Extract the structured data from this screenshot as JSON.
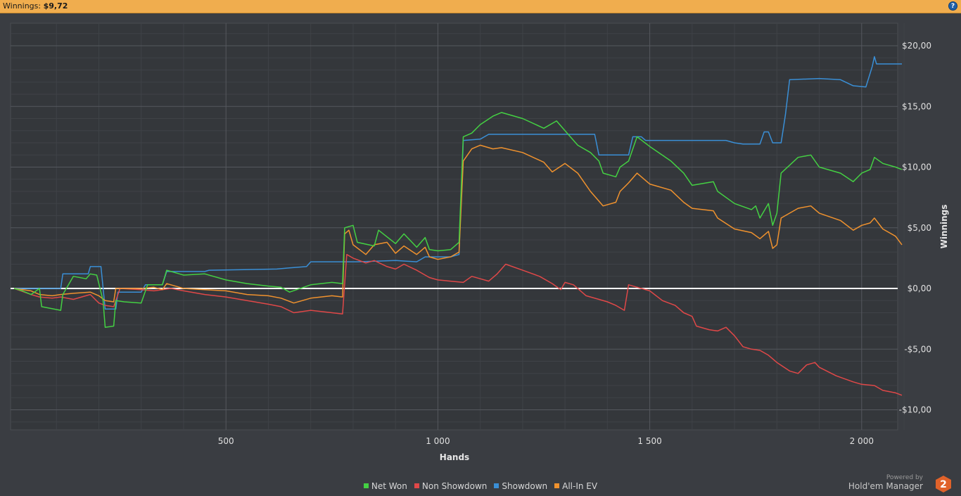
{
  "header": {
    "winnings_label": "Winnings:",
    "winnings_value": "$9,72",
    "help_icon": "help-icon"
  },
  "chart_data": {
    "type": "line",
    "xlabel": "Hands",
    "ylabel": "Winnings",
    "xlim": [
      0,
      2100
    ],
    "ylim": [
      -11.5,
      21.5
    ],
    "x_ticks": [
      500,
      1000,
      1500,
      2000
    ],
    "x_tick_labels": [
      "500",
      "1 000",
      "1 500",
      "2 000"
    ],
    "y_ticks": [
      20,
      15,
      10,
      5,
      0,
      -5,
      -10
    ],
    "y_tick_labels": [
      "$20,00",
      "$15,00",
      "$10,00",
      "$5,00",
      "$0,00",
      "-$5,00",
      "-$10,00"
    ],
    "grid": true,
    "legend_position": "bottom-center",
    "zero_line": true,
    "series": [
      {
        "name": "Net Won",
        "color": "#44d043",
        "points": [
          [
            0,
            0
          ],
          [
            20,
            -0.2
          ],
          [
            40,
            -0.5
          ],
          [
            60,
            0
          ],
          [
            65,
            -1.5
          ],
          [
            110,
            -1.8
          ],
          [
            115,
            -0.5
          ],
          [
            140,
            1
          ],
          [
            170,
            0.8
          ],
          [
            180,
            1.2
          ],
          [
            195,
            1.1
          ],
          [
            210,
            -1
          ],
          [
            215,
            -3.2
          ],
          [
            235,
            -3.1
          ],
          [
            240,
            -1
          ],
          [
            260,
            -1.1
          ],
          [
            300,
            -1.2
          ],
          [
            315,
            0.3
          ],
          [
            350,
            0.3
          ],
          [
            360,
            1.5
          ],
          [
            400,
            1.1
          ],
          [
            450,
            1.2
          ],
          [
            500,
            0.7
          ],
          [
            550,
            0.4
          ],
          [
            600,
            0.2
          ],
          [
            630,
            0.1
          ],
          [
            650,
            -0.3
          ],
          [
            700,
            0.3
          ],
          [
            750,
            0.5
          ],
          [
            775,
            0.4
          ],
          [
            780,
            5
          ],
          [
            800,
            5.2
          ],
          [
            810,
            3.8
          ],
          [
            850,
            3.5
          ],
          [
            860,
            4.8
          ],
          [
            900,
            3.7
          ],
          [
            920,
            4.5
          ],
          [
            950,
            3.4
          ],
          [
            970,
            4.2
          ],
          [
            980,
            3.2
          ],
          [
            1000,
            3.1
          ],
          [
            1030,
            3.2
          ],
          [
            1050,
            3.8
          ],
          [
            1060,
            12.5
          ],
          [
            1080,
            12.8
          ],
          [
            1100,
            13.5
          ],
          [
            1130,
            14.2
          ],
          [
            1150,
            14.5
          ],
          [
            1200,
            14
          ],
          [
            1250,
            13.2
          ],
          [
            1280,
            13.8
          ],
          [
            1300,
            13
          ],
          [
            1330,
            11.8
          ],
          [
            1360,
            11.2
          ],
          [
            1380,
            10.5
          ],
          [
            1390,
            9.5
          ],
          [
            1420,
            9.2
          ],
          [
            1430,
            10
          ],
          [
            1450,
            10.5
          ],
          [
            1470,
            12.5
          ],
          [
            1500,
            11.7
          ],
          [
            1550,
            10.5
          ],
          [
            1580,
            9.5
          ],
          [
            1600,
            8.5
          ],
          [
            1650,
            8.8
          ],
          [
            1660,
            8
          ],
          [
            1700,
            7
          ],
          [
            1740,
            6.5
          ],
          [
            1750,
            6.8
          ],
          [
            1760,
            5.8
          ],
          [
            1780,
            7
          ],
          [
            1790,
            5.2
          ],
          [
            1800,
            6.2
          ],
          [
            1810,
            9.5
          ],
          [
            1850,
            10.8
          ],
          [
            1880,
            11
          ],
          [
            1900,
            10
          ],
          [
            1950,
            9.5
          ],
          [
            1980,
            8.8
          ],
          [
            2000,
            9.5
          ],
          [
            2020,
            9.8
          ],
          [
            2030,
            10.8
          ],
          [
            2050,
            10.3
          ],
          [
            2080,
            10
          ],
          [
            2095,
            9.8
          ]
        ]
      },
      {
        "name": "Non Showdown",
        "color": "#e04848",
        "points": [
          [
            0,
            0
          ],
          [
            40,
            -0.5
          ],
          [
            60,
            -0.7
          ],
          [
            90,
            -0.8
          ],
          [
            110,
            -0.7
          ],
          [
            140,
            -0.9
          ],
          [
            180,
            -0.5
          ],
          [
            200,
            -1.2
          ],
          [
            215,
            -1.4
          ],
          [
            235,
            -1.5
          ],
          [
            250,
            0
          ],
          [
            300,
            -0.1
          ],
          [
            330,
            -0.2
          ],
          [
            370,
            0
          ],
          [
            400,
            -0.2
          ],
          [
            450,
            -0.5
          ],
          [
            500,
            -0.7
          ],
          [
            550,
            -1
          ],
          [
            600,
            -1.3
          ],
          [
            630,
            -1.5
          ],
          [
            660,
            -2
          ],
          [
            700,
            -1.8
          ],
          [
            750,
            -2
          ],
          [
            775,
            -2.1
          ],
          [
            785,
            2.8
          ],
          [
            800,
            2.5
          ],
          [
            830,
            2.1
          ],
          [
            850,
            2.3
          ],
          [
            880,
            1.8
          ],
          [
            900,
            1.6
          ],
          [
            920,
            2
          ],
          [
            950,
            1.5
          ],
          [
            980,
            0.9
          ],
          [
            1000,
            0.7
          ],
          [
            1030,
            0.6
          ],
          [
            1060,
            0.5
          ],
          [
            1080,
            1
          ],
          [
            1100,
            0.8
          ],
          [
            1120,
            0.6
          ],
          [
            1140,
            1.2
          ],
          [
            1160,
            2
          ],
          [
            1200,
            1.5
          ],
          [
            1240,
            1
          ],
          [
            1270,
            0.4
          ],
          [
            1290,
            -0.1
          ],
          [
            1300,
            0.5
          ],
          [
            1320,
            0.3
          ],
          [
            1350,
            -0.6
          ],
          [
            1380,
            -0.9
          ],
          [
            1400,
            -1.1
          ],
          [
            1420,
            -1.4
          ],
          [
            1440,
            -1.8
          ],
          [
            1450,
            0.3
          ],
          [
            1480,
            0
          ],
          [
            1500,
            -0.2
          ],
          [
            1530,
            -1
          ],
          [
            1560,
            -1.4
          ],
          [
            1580,
            -2
          ],
          [
            1600,
            -2.3
          ],
          [
            1610,
            -3.1
          ],
          [
            1640,
            -3.4
          ],
          [
            1660,
            -3.5
          ],
          [
            1680,
            -3.2
          ],
          [
            1700,
            -3.9
          ],
          [
            1720,
            -4.8
          ],
          [
            1740,
            -5
          ],
          [
            1760,
            -5.1
          ],
          [
            1780,
            -5.5
          ],
          [
            1800,
            -6.1
          ],
          [
            1830,
            -6.8
          ],
          [
            1850,
            -7
          ],
          [
            1870,
            -6.3
          ],
          [
            1890,
            -6.1
          ],
          [
            1900,
            -6.5
          ],
          [
            1940,
            -7.2
          ],
          [
            1980,
            -7.7
          ],
          [
            2000,
            -7.9
          ],
          [
            2030,
            -8
          ],
          [
            2050,
            -8.4
          ],
          [
            2080,
            -8.6
          ],
          [
            2095,
            -8.8
          ]
        ]
      },
      {
        "name": "Showdown",
        "color": "#3a8fd6",
        "points": [
          [
            0,
            0
          ],
          [
            110,
            0
          ],
          [
            115,
            1.2
          ],
          [
            175,
            1.2
          ],
          [
            180,
            1.8
          ],
          [
            205,
            1.8
          ],
          [
            215,
            -1.7
          ],
          [
            240,
            -1.7
          ],
          [
            245,
            -0.3
          ],
          [
            300,
            -0.3
          ],
          [
            310,
            0.3
          ],
          [
            350,
            0.3
          ],
          [
            360,
            1.4
          ],
          [
            450,
            1.4
          ],
          [
            460,
            1.5
          ],
          [
            620,
            1.6
          ],
          [
            650,
            1.7
          ],
          [
            690,
            1.8
          ],
          [
            700,
            2.2
          ],
          [
            800,
            2.2
          ],
          [
            810,
            2.2
          ],
          [
            900,
            2.3
          ],
          [
            950,
            2.2
          ],
          [
            970,
            2.6
          ],
          [
            1000,
            2.6
          ],
          [
            1030,
            2.6
          ],
          [
            1050,
            2.8
          ],
          [
            1060,
            12.2
          ],
          [
            1100,
            12.3
          ],
          [
            1120,
            12.7
          ],
          [
            1200,
            12.7
          ],
          [
            1300,
            12.7
          ],
          [
            1370,
            12.7
          ],
          [
            1380,
            11
          ],
          [
            1420,
            11
          ],
          [
            1440,
            11
          ],
          [
            1450,
            11
          ],
          [
            1460,
            12.5
          ],
          [
            1480,
            12.5
          ],
          [
            1490,
            12.2
          ],
          [
            1680,
            12.2
          ],
          [
            1700,
            12
          ],
          [
            1720,
            11.9
          ],
          [
            1760,
            11.9
          ],
          [
            1770,
            12.9
          ],
          [
            1780,
            12.9
          ],
          [
            1790,
            12
          ],
          [
            1810,
            12
          ],
          [
            1820,
            14.3
          ],
          [
            1830,
            17.2
          ],
          [
            1900,
            17.3
          ],
          [
            1950,
            17.2
          ],
          [
            1980,
            16.7
          ],
          [
            2010,
            16.6
          ],
          [
            2025,
            18.3
          ],
          [
            2030,
            19.1
          ],
          [
            2035,
            18.5
          ],
          [
            2095,
            18.5
          ]
        ]
      },
      {
        "name": "All-In EV",
        "color": "#f0922e",
        "points": [
          [
            0,
            0
          ],
          [
            40,
            -0.2
          ],
          [
            60,
            -0.5
          ],
          [
            90,
            -0.6
          ],
          [
            110,
            -0.5
          ],
          [
            140,
            -0.4
          ],
          [
            180,
            -0.3
          ],
          [
            200,
            -0.6
          ],
          [
            215,
            -1
          ],
          [
            235,
            -1.1
          ],
          [
            240,
            0
          ],
          [
            300,
            0
          ],
          [
            330,
            0.1
          ],
          [
            350,
            -0.1
          ],
          [
            360,
            0.4
          ],
          [
            400,
            0
          ],
          [
            450,
            -0.1
          ],
          [
            500,
            -0.2
          ],
          [
            550,
            -0.5
          ],
          [
            600,
            -0.6
          ],
          [
            630,
            -0.8
          ],
          [
            660,
            -1.2
          ],
          [
            700,
            -0.8
          ],
          [
            750,
            -0.6
          ],
          [
            775,
            -0.7
          ],
          [
            780,
            4.5
          ],
          [
            790,
            4.8
          ],
          [
            800,
            3.6
          ],
          [
            830,
            2.8
          ],
          [
            850,
            3.6
          ],
          [
            880,
            3.8
          ],
          [
            900,
            2.9
          ],
          [
            920,
            3.5
          ],
          [
            950,
            2.8
          ],
          [
            970,
            3.4
          ],
          [
            980,
            2.6
          ],
          [
            1000,
            2.4
          ],
          [
            1030,
            2.6
          ],
          [
            1050,
            3
          ],
          [
            1060,
            10.5
          ],
          [
            1080,
            11.5
          ],
          [
            1100,
            11.8
          ],
          [
            1130,
            11.5
          ],
          [
            1150,
            11.6
          ],
          [
            1200,
            11.2
          ],
          [
            1250,
            10.4
          ],
          [
            1270,
            9.6
          ],
          [
            1300,
            10.3
          ],
          [
            1330,
            9.5
          ],
          [
            1360,
            8
          ],
          [
            1390,
            6.8
          ],
          [
            1420,
            7.1
          ],
          [
            1430,
            8
          ],
          [
            1450,
            8.7
          ],
          [
            1470,
            9.5
          ],
          [
            1500,
            8.6
          ],
          [
            1550,
            8.1
          ],
          [
            1580,
            7.1
          ],
          [
            1600,
            6.6
          ],
          [
            1650,
            6.4
          ],
          [
            1660,
            5.8
          ],
          [
            1700,
            4.9
          ],
          [
            1740,
            4.6
          ],
          [
            1760,
            4.1
          ],
          [
            1780,
            4.7
          ],
          [
            1790,
            3.3
          ],
          [
            1800,
            3.6
          ],
          [
            1810,
            5.8
          ],
          [
            1850,
            6.6
          ],
          [
            1880,
            6.8
          ],
          [
            1900,
            6.2
          ],
          [
            1950,
            5.6
          ],
          [
            1980,
            4.8
          ],
          [
            2000,
            5.2
          ],
          [
            2020,
            5.4
          ],
          [
            2030,
            5.8
          ],
          [
            2050,
            4.9
          ],
          [
            2080,
            4.3
          ],
          [
            2095,
            3.6
          ]
        ]
      }
    ]
  },
  "legend": [
    {
      "label": "Net Won",
      "color": "#44d043"
    },
    {
      "label": "Non Showdown",
      "color": "#e04848"
    },
    {
      "label": "Showdown",
      "color": "#3a8fd6"
    },
    {
      "label": "All-In EV",
      "color": "#f0922e"
    }
  ],
  "branding": {
    "powered_by": "Powered by",
    "name": "Hold'em Manager",
    "logo_text": "2",
    "logo_color": "#e0622a"
  }
}
